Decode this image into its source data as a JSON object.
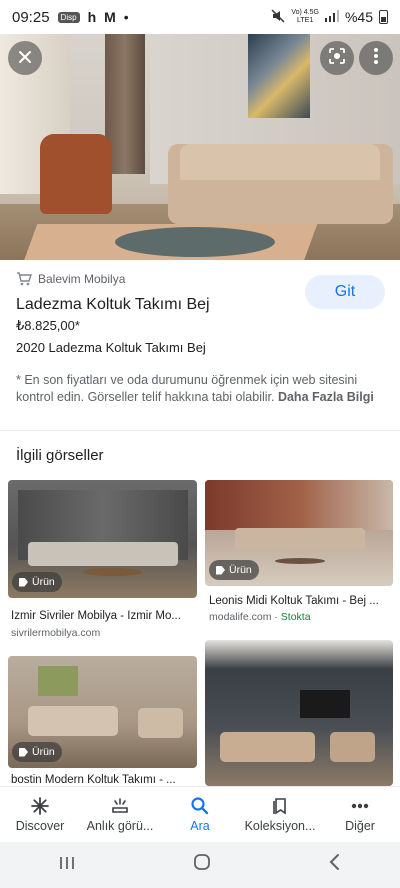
{
  "status_bar": {
    "time": "09:25",
    "notif_chip": "Disp",
    "notif_h": "h",
    "notif_mail": "M",
    "notif_dot": "•",
    "network": "Vo) 4.5G\nLTE1",
    "battery": "%45"
  },
  "hero": {
    "close_icon": "close-icon",
    "lens_icon": "lens-icon",
    "more_icon": "more-vert-icon"
  },
  "result": {
    "source": "Balevim Mobilya",
    "title": "Ladezma Koltuk Takımı Bej",
    "price": "₺8.825,00*",
    "subtitle": "2020 Ladezma Koltuk Takımı Bej",
    "visit_label": "Git",
    "disclaimer": "* En son fiyatları ve oda durumunu öğrenmek için web sitesini kontrol edin. Görseller telif hakkına tabi olabilir.",
    "more_info": "Daha Fazla Bilgi"
  },
  "related": {
    "heading": "İlgili görseller",
    "badge_label": "Ürün",
    "cards": [
      {
        "title": "İzmir Sivriler Mobilya - İzmir Mo...",
        "source": "sivrilermobilya.com",
        "stock": ""
      },
      {
        "title": "Leonis Midi Koltuk Takımı - Bej ...",
        "source": "modalife.com",
        "stock": "Stokta"
      },
      {
        "title": "bostin Modern Koltuk Takımı - ...",
        "source": "",
        "stock": ""
      },
      {
        "title": "",
        "source": "",
        "stock": ""
      }
    ]
  },
  "bottom_nav": [
    {
      "label": "Discover",
      "icon": "asterisk-icon"
    },
    {
      "label": "Anlık görü...",
      "icon": "snapshot-icon"
    },
    {
      "label": "Ara",
      "icon": "search-icon"
    },
    {
      "label": "Koleksiyon...",
      "icon": "bookmark-icon"
    },
    {
      "label": "Diğer",
      "icon": "more-horiz-icon"
    }
  ],
  "colors": {
    "accent": "#1a73e8",
    "git_bg": "#e8f0fe",
    "stock_green": "#188038"
  }
}
